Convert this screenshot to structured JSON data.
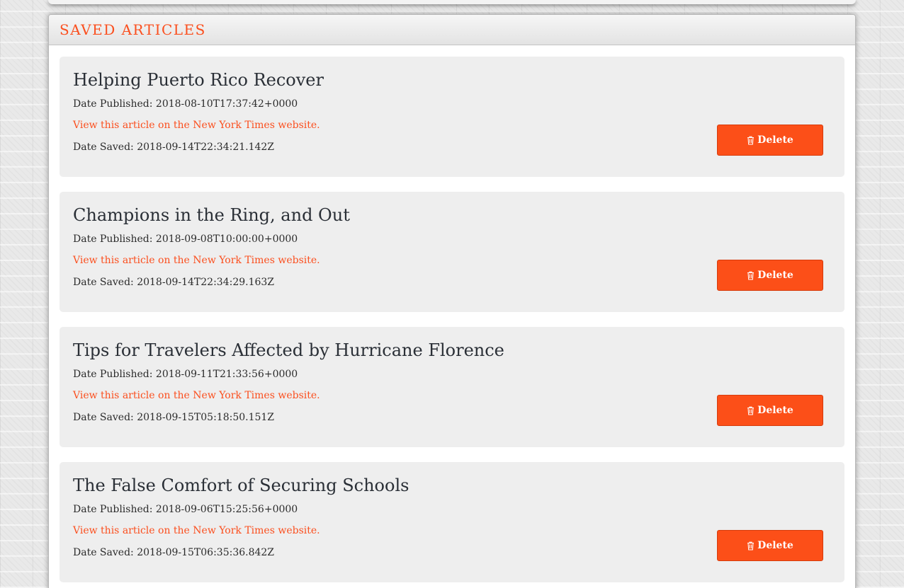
{
  "panel": {
    "title": "SAVED ARTICLES"
  },
  "colors": {
    "accent": "#fb4f1e",
    "card_background": "#eeeeee",
    "title_text": "#2a2f36"
  },
  "articles": [
    {
      "title": "Helping Puerto Rico Recover",
      "published_label": "Date Published:",
      "published": "2018-08-10T17:37:42+0000",
      "link_text": "View this article on the New York Times website.",
      "saved_label": "Date Saved:",
      "saved": "2018-09-14T22:34:21.142Z",
      "delete_label": "Delete",
      "delete_icon": "trash-icon"
    },
    {
      "title": "Champions in the Ring, and Out",
      "published_label": "Date Published:",
      "published": "2018-09-08T10:00:00+0000",
      "link_text": "View this article on the New York Times website.",
      "saved_label": "Date Saved:",
      "saved": "2018-09-14T22:34:29.163Z",
      "delete_label": "Delete",
      "delete_icon": "trash-icon"
    },
    {
      "title": "Tips for Travelers Affected by Hurricane Florence",
      "published_label": "Date Published:",
      "published": "2018-09-11T21:33:56+0000",
      "link_text": "View this article on the New York Times website.",
      "saved_label": "Date Saved:",
      "saved": "2018-09-15T05:18:50.151Z",
      "delete_label": "Delete",
      "delete_icon": "trash-icon"
    },
    {
      "title": "The False Comfort of Securing Schools",
      "published_label": "Date Published:",
      "published": "2018-09-06T15:25:56+0000",
      "link_text": "View this article on the New York Times website.",
      "saved_label": "Date Saved:",
      "saved": "2018-09-15T06:35:36.842Z",
      "delete_label": "Delete",
      "delete_icon": "trash-icon"
    }
  ]
}
